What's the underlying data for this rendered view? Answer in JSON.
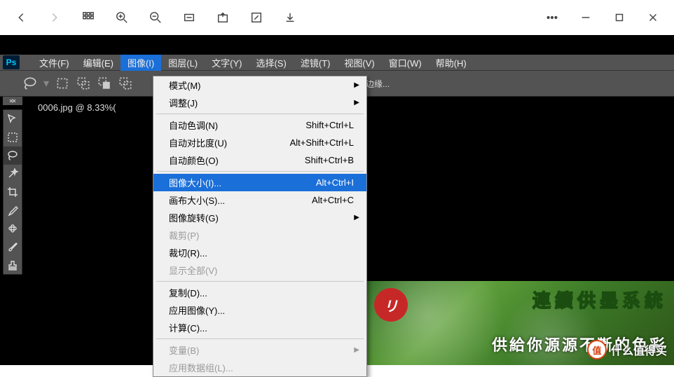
{
  "browser": {
    "icons": [
      "back",
      "forward",
      "apps",
      "zoom-in",
      "zoom-out",
      "actual-size",
      "open",
      "edit",
      "download",
      "more",
      "minimize",
      "maximize",
      "close"
    ]
  },
  "ps": {
    "logo": "Ps",
    "menus": [
      {
        "label": "文件(F)",
        "active": false
      },
      {
        "label": "编辑(E)",
        "active": false
      },
      {
        "label": "图像(I)",
        "active": true
      },
      {
        "label": "图层(L)",
        "active": false
      },
      {
        "label": "文字(Y)",
        "active": false
      },
      {
        "label": "选择(S)",
        "active": false
      },
      {
        "label": "滤镜(T)",
        "active": false
      },
      {
        "label": "视图(V)",
        "active": false
      },
      {
        "label": "窗口(W)",
        "active": false
      },
      {
        "label": "帮助(H)",
        "active": false
      }
    ],
    "options_bar_text": "调整边缘...",
    "doc_tab": "0006.jpg @ 8.33%(",
    "dropdown": {
      "groups": [
        [
          {
            "label": "模式(M)",
            "shortcut": "",
            "submenu": true,
            "disabled": false,
            "highlight": false
          },
          {
            "label": "调整(J)",
            "shortcut": "",
            "submenu": true,
            "disabled": false,
            "highlight": false
          }
        ],
        [
          {
            "label": "自动色调(N)",
            "shortcut": "Shift+Ctrl+L",
            "submenu": false,
            "disabled": false,
            "highlight": false
          },
          {
            "label": "自动对比度(U)",
            "shortcut": "Alt+Shift+Ctrl+L",
            "submenu": false,
            "disabled": false,
            "highlight": false
          },
          {
            "label": "自动颜色(O)",
            "shortcut": "Shift+Ctrl+B",
            "submenu": false,
            "disabled": false,
            "highlight": false
          }
        ],
        [
          {
            "label": "图像大小(I)...",
            "shortcut": "Alt+Ctrl+I",
            "submenu": false,
            "disabled": false,
            "highlight": true
          },
          {
            "label": "画布大小(S)...",
            "shortcut": "Alt+Ctrl+C",
            "submenu": false,
            "disabled": false,
            "highlight": false
          },
          {
            "label": "图像旋转(G)",
            "shortcut": "",
            "submenu": true,
            "disabled": false,
            "highlight": false
          },
          {
            "label": "裁剪(P)",
            "shortcut": "",
            "submenu": false,
            "disabled": true,
            "highlight": false
          },
          {
            "label": "裁切(R)...",
            "shortcut": "",
            "submenu": false,
            "disabled": false,
            "highlight": false
          },
          {
            "label": "显示全部(V)",
            "shortcut": "",
            "submenu": false,
            "disabled": true,
            "highlight": false
          }
        ],
        [
          {
            "label": "复制(D)...",
            "shortcut": "",
            "submenu": false,
            "disabled": false,
            "highlight": false
          },
          {
            "label": "应用图像(Y)...",
            "shortcut": "",
            "submenu": false,
            "disabled": false,
            "highlight": false
          },
          {
            "label": "计算(C)...",
            "shortcut": "",
            "submenu": false,
            "disabled": false,
            "highlight": false
          }
        ],
        [
          {
            "label": "变量(B)",
            "shortcut": "",
            "submenu": true,
            "disabled": true,
            "highlight": false
          },
          {
            "label": "应用数据组(L)...",
            "shortcut": "",
            "submenu": false,
            "disabled": true,
            "highlight": false
          }
        ]
      ]
    },
    "canvas_text": {
      "emblem": "リ",
      "line1": "連續供墨系統",
      "line2": "供給你源源不斷的色彩"
    }
  },
  "watermark": {
    "badge": "值",
    "text": "什么值得买"
  }
}
